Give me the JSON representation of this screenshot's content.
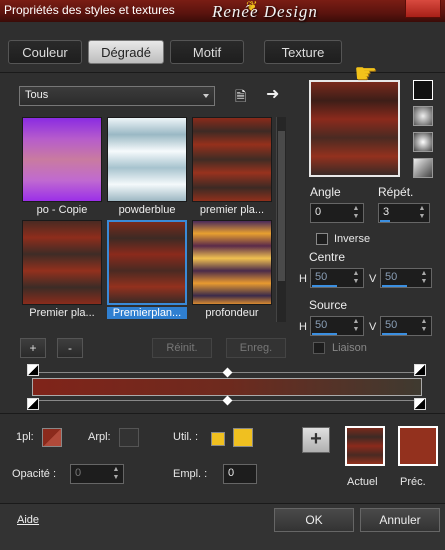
{
  "window": {
    "title": "Propriétés des styles et textures",
    "brand": "Renée Design"
  },
  "tabs": [
    {
      "label": "Couleur"
    },
    {
      "label": "Dégradé"
    },
    {
      "label": "Motif"
    },
    {
      "label": "Texture"
    }
  ],
  "library": {
    "category": "Tous",
    "swatches": [
      {
        "label": "po - Copie"
      },
      {
        "label": "powderblue"
      },
      {
        "label": "premier pla..."
      },
      {
        "label": "Premier pla..."
      },
      {
        "label": "Premierplan..."
      },
      {
        "label": "profondeur"
      }
    ],
    "add_label": "+",
    "remove_label": "-",
    "reset_label": "Réinit.",
    "save_label": "Enreg."
  },
  "settings": {
    "angle_label": "Angle",
    "angle_value": "0",
    "repeat_label": "Répét.",
    "repeat_value": "3",
    "invert_label": "Inverse",
    "center_label": "Centre",
    "center_h_label": "H",
    "center_h_value": "50",
    "center_v_label": "V",
    "center_v_value": "50",
    "source_label": "Source",
    "source_h_label": "H",
    "source_h_value": "50",
    "source_v_label": "V",
    "source_v_value": "50",
    "link_label": "Liaison"
  },
  "bottom": {
    "fg_label": "1pl:",
    "bg_label": "Arpl:",
    "user_label": "Util. :",
    "opacity_label": "Opacité :",
    "opacity_value": "0",
    "location_label": "Empl. :",
    "location_value": "0",
    "current_label": "Actuel",
    "previous_label": "Préc.",
    "colors": {
      "fg": "#8b2a1c",
      "user": "#f0c020",
      "current": "#7a2a1c",
      "previous": "#93311e"
    }
  },
  "footer": {
    "help_label": "Aide",
    "ok_label": "OK",
    "cancel_label": "Annuler"
  }
}
